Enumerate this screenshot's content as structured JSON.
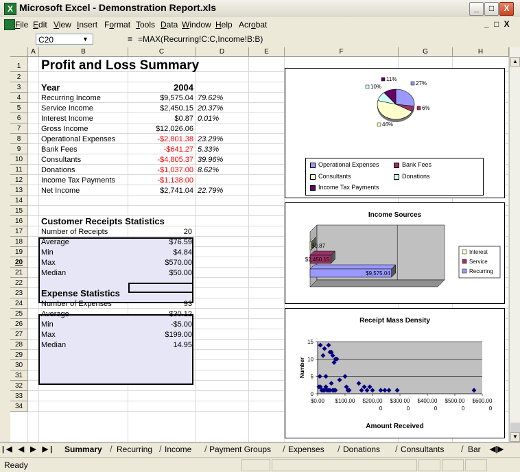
{
  "window": {
    "title": "Microsoft Excel - Demonstration Report.xls",
    "minimize": "_",
    "maximize": "□",
    "close": "X"
  },
  "menu": [
    "File",
    "Edit",
    "View",
    "Insert",
    "Format",
    "Tools",
    "Data",
    "Window",
    "Help",
    "Acrobat"
  ],
  "menu_underline_index": [
    0,
    0,
    0,
    0,
    1,
    0,
    0,
    0,
    0,
    3
  ],
  "formula_bar": {
    "name_box": "C20",
    "equals": "=",
    "formula": "=MAX(Recurring!C:C,Income!B:B)"
  },
  "columns": [
    "A",
    "B",
    "C",
    "D",
    "E",
    "F",
    "G",
    "H"
  ],
  "rows": [
    "1",
    "2",
    "3",
    "4",
    "5",
    "6",
    "7",
    "8",
    "9",
    "10",
    "11",
    "12",
    "13",
    "14",
    "15",
    "16",
    "17",
    "18",
    "19",
    "20",
    "21",
    "22",
    "23",
    "24",
    "25",
    "26",
    "27",
    "28",
    "29",
    "30",
    "31",
    "32",
    "33",
    "34"
  ],
  "sheet": {
    "title": "Profit and Loss Summary",
    "year_label": "Year",
    "year_value": "2004",
    "pl_rows": [
      {
        "label": "Recurring Income",
        "value": "$9,575.04",
        "pct": "79.62%",
        "neg": false
      },
      {
        "label": "Service Income",
        "value": "$2,450.15",
        "pct": "20.37%",
        "neg": false
      },
      {
        "label": "Interest Income",
        "value": "$0.87",
        "pct": "0.01%",
        "neg": false
      },
      {
        "label": "Gross Income",
        "value": "$12,026.06",
        "pct": "",
        "neg": false
      },
      {
        "label": "Operational Expenses",
        "value": "-$2,801.38",
        "pct": "23.29%",
        "neg": true
      },
      {
        "label": "Bank Fees",
        "value": "-$641.27",
        "pct": "5.33%",
        "neg": true
      },
      {
        "label": "Consultants",
        "value": "-$4,805.37",
        "pct": "39.96%",
        "neg": true
      },
      {
        "label": "Donations",
        "value": "-$1,037.00",
        "pct": "8.62%",
        "neg": true
      },
      {
        "label": "Income Tax Payments",
        "value": "-$1,138.00",
        "pct": "",
        "neg": true
      },
      {
        "label": "Net Income",
        "value": "$2,741.04",
        "pct": "22.79%",
        "neg": false
      }
    ],
    "customer_stats": {
      "title": "Customer Receipts Statistics",
      "rows": [
        {
          "label": "Number of Receipts",
          "value": "20"
        },
        {
          "label": "Average",
          "value": "$76.59"
        },
        {
          "label": "Min",
          "value": "$4.84"
        },
        {
          "label": "Max",
          "value": "$570.00"
        },
        {
          "label": "Median",
          "value": "$50.00"
        }
      ]
    },
    "expense_stats": {
      "title": "Expense Statistics",
      "rows": [
        {
          "label": "Number of Expenses",
          "value": "93"
        },
        {
          "label": "Average",
          "value": "$30.12"
        },
        {
          "label": "Min",
          "value": "-$5.00"
        },
        {
          "label": "Max",
          "value": "$199.00"
        },
        {
          "label": "Median",
          "value": "14.95"
        }
      ]
    }
  },
  "chart_data": [
    {
      "type": "pie",
      "title": "",
      "categories": [
        "Operational Expenses",
        "Bank Fees",
        "Consultants",
        "Donations",
        "Income Tax Payments"
      ],
      "values": [
        27,
        6,
        46,
        10,
        11
      ],
      "labels": [
        "27%",
        "6%",
        "46%",
        "10%",
        "11%"
      ],
      "colors": [
        "#9999ff",
        "#993366",
        "#ffffcc",
        "#ccffff",
        "#660066"
      ],
      "legend": "bottom"
    },
    {
      "type": "bar",
      "title": "Income Sources",
      "orientation": "horizontal",
      "categories": [
        "Recurring",
        "Service",
        "Interest"
      ],
      "values": [
        9575.04,
        2450.15,
        0.87
      ],
      "labels": [
        "$9,575.04",
        "$2,450.15",
        "$0.87"
      ],
      "colors": [
        "#9999ff",
        "#993366",
        "#ffffcc"
      ],
      "legend": "right"
    },
    {
      "type": "scatter",
      "title": "Receipt Mass Density",
      "xlabel": "Amount Received",
      "ylabel": "Number",
      "xlim": [
        0,
        600
      ],
      "ylim": [
        0,
        15
      ],
      "x_ticks": [
        "$0.00",
        "$100.00",
        "$200.00",
        "$300.00",
        "$400.00",
        "$500.00",
        "$600.00"
      ],
      "x_ticks_line2": [
        "",
        "",
        "0",
        "0",
        "0",
        "0",
        "0"
      ],
      "y_ticks": [
        "0",
        "5",
        "10",
        "15"
      ],
      "color": "#000080",
      "points": [
        [
          10,
          14
        ],
        [
          20,
          11
        ],
        [
          25,
          13
        ],
        [
          40,
          14
        ],
        [
          45,
          12
        ],
        [
          50,
          12
        ],
        [
          55,
          11
        ],
        [
          60,
          9
        ],
        [
          65,
          10
        ],
        [
          70,
          10
        ],
        [
          8,
          5
        ],
        [
          30,
          5
        ],
        [
          50,
          3
        ],
        [
          80,
          4
        ],
        [
          5,
          2
        ],
        [
          10,
          2
        ],
        [
          15,
          1
        ],
        [
          20,
          1
        ],
        [
          25,
          1
        ],
        [
          30,
          2
        ],
        [
          35,
          1
        ],
        [
          40,
          1
        ],
        [
          45,
          1
        ],
        [
          55,
          1
        ],
        [
          60,
          1
        ],
        [
          65,
          1
        ],
        [
          100,
          5
        ],
        [
          105,
          2
        ],
        [
          110,
          1
        ],
        [
          115,
          1
        ],
        [
          150,
          3
        ],
        [
          160,
          1
        ],
        [
          170,
          2
        ],
        [
          180,
          1
        ],
        [
          190,
          2
        ],
        [
          200,
          1
        ],
        [
          230,
          1
        ],
        [
          245,
          1
        ],
        [
          260,
          1
        ],
        [
          290,
          1
        ],
        [
          570,
          1
        ]
      ]
    }
  ],
  "tabs": [
    "Summary",
    "Recurring",
    "Income",
    "Payment Groups",
    "Expenses",
    "Donations",
    "Consultants",
    "Bar"
  ],
  "status": "Ready"
}
